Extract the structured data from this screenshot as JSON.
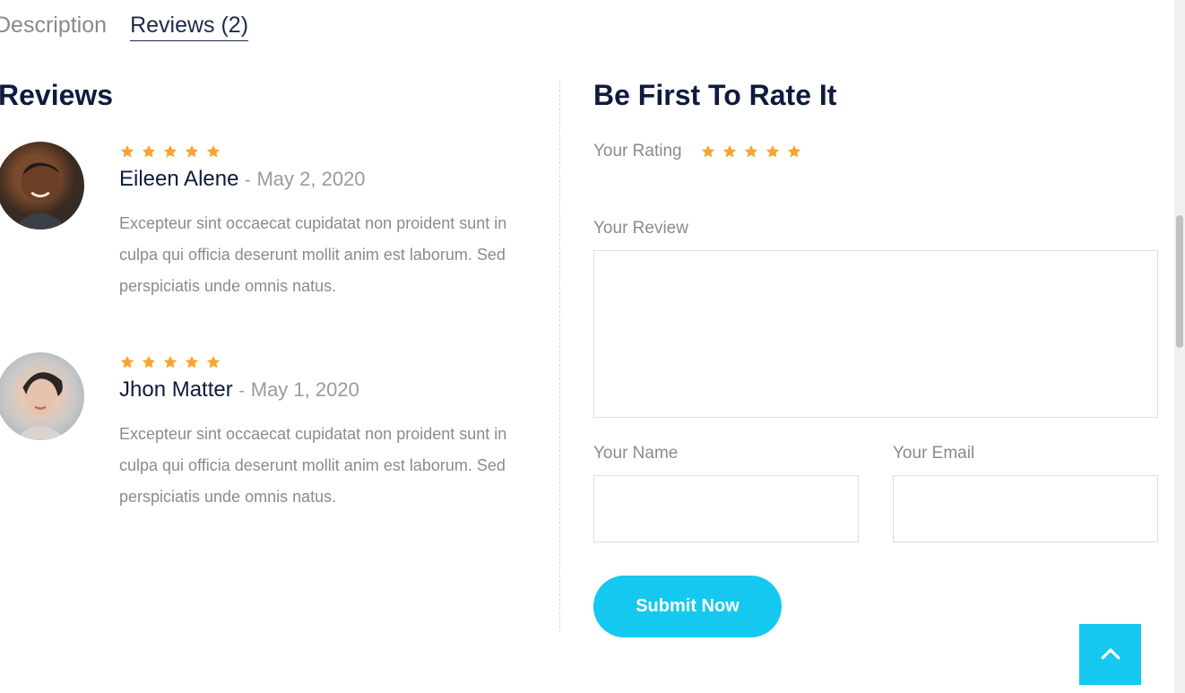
{
  "tabs": [
    {
      "label": "Description",
      "active": false
    },
    {
      "label": "Reviews (2)",
      "active": true
    }
  ],
  "reviews_section": {
    "title": "Reviews",
    "items": [
      {
        "name": "Eileen Alene",
        "separator": "-",
        "date": "May 2, 2020",
        "stars": 5,
        "text": "Excepteur sint occaecat cupidatat non proident sunt in culpa qui officia deserunt mollit anim est laborum. Sed perspiciatis unde omnis natus."
      },
      {
        "name": "Jhon Matter",
        "separator": "-",
        "date": "May 1, 2020",
        "stars": 5,
        "text": "Excepteur sint occaecat cupidatat non proident sunt in culpa qui officia deserunt mollit anim est laborum. Sed perspiciatis unde omnis natus."
      }
    ]
  },
  "review_form": {
    "title": "Be First To Rate It",
    "rating_label": "Your Rating",
    "rating_stars": 5,
    "review_label": "Your Review",
    "review_value": "",
    "name_label": "Your Name",
    "name_value": "",
    "email_label": "Your Email",
    "email_value": "",
    "submit_label": "Submit Now"
  },
  "icons": {
    "star": "star-icon",
    "back_to_top": "chevron-up-icon"
  },
  "colors": {
    "accent": "#14c8f0",
    "star": "#f7a530",
    "heading": "#0f1b3d",
    "muted_text": "#8b8b8b"
  }
}
